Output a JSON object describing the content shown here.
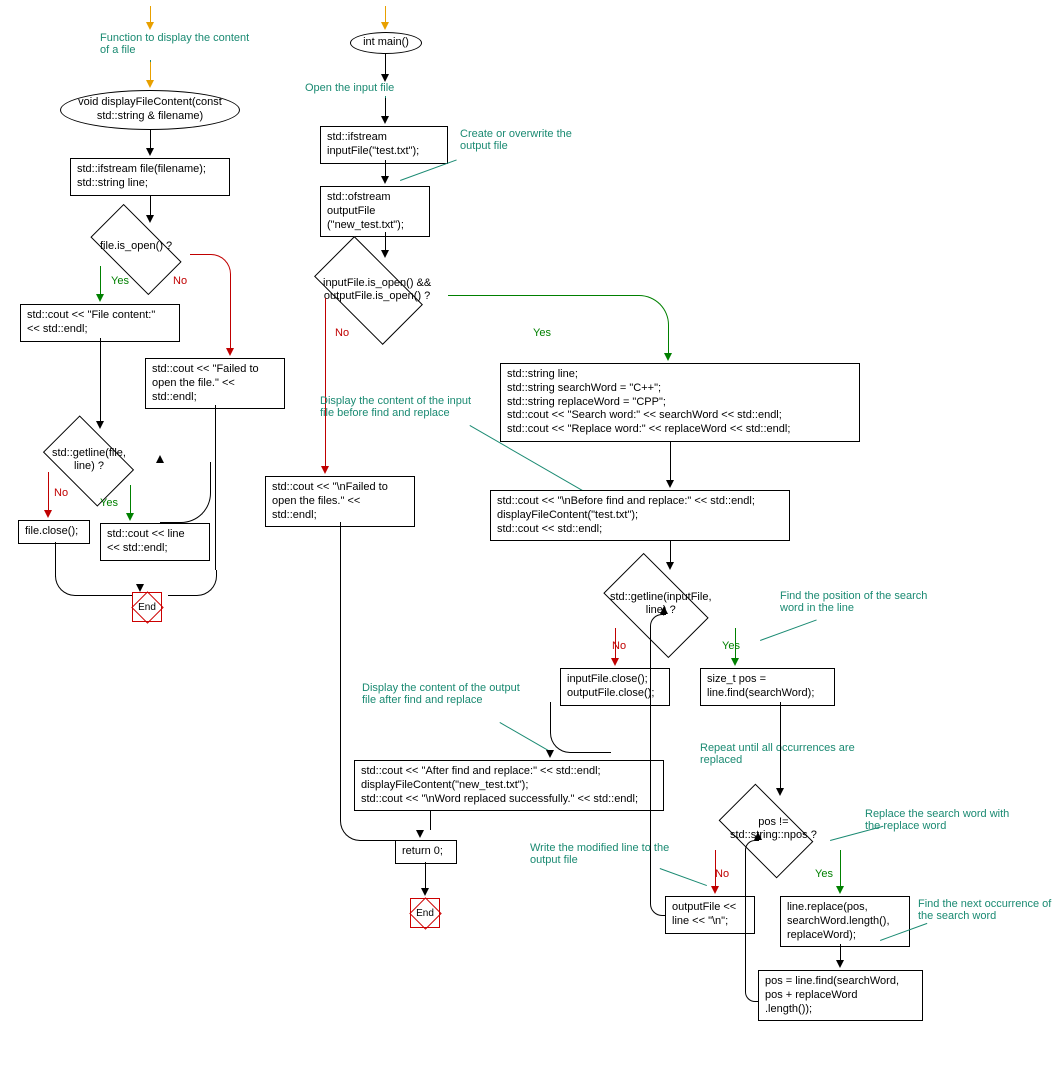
{
  "left": {
    "annot_func": "Function to display the\ncontent of a file",
    "func_decl": "void displayFileContent(const\nstd::string & filename)",
    "b1": "std::ifstream file(filename);\nstd::string line;",
    "d1": "file.is_open() ?",
    "yes1": "Yes",
    "no1": "No",
    "b2": "std::cout << \"File content:\"\n<< std::endl;",
    "b3": "std::cout << \"Failed to\nopen the file.\" <<\nstd::endl;",
    "d2": "std::getline(file,\nline) ?",
    "yes2": "Yes",
    "no2": "No",
    "b4": "file.close();",
    "b5": "std::cout << line\n<< std::endl;",
    "end": "End"
  },
  "right": {
    "main": "int main()",
    "annot_open": "Open the input file",
    "b1": "std::ifstream\ninputFile(\"test.txt\");",
    "annot_create": "Create or overwrite\nthe output file",
    "b2": "std::ofstream\noutputFile\n(\"new_test.txt\");",
    "d1": "inputFile.is_open() &&\noutputFile.is_open() ?",
    "yes1": "Yes",
    "no1": "No",
    "annot_before": "Display the content of the\ninput file before find and\nreplace",
    "b3": "std::cout << \"\\nFailed to\nopen the files.\" <<\nstd::endl;",
    "b4": "std::string line;\nstd::string searchWord = \"C++\";\nstd::string replaceWord = \"CPP\";\nstd::cout << \"Search word:\" << searchWord << std::endl;\nstd::cout << \"Replace word:\" << replaceWord << std::endl;",
    "b5": "std::cout << \"\\nBefore find and replace:\" << std::endl;\ndisplayFileContent(\"test.txt\");\nstd::cout << std::endl;",
    "d2": "std::getline(inputFile,\nline) ?",
    "yes2": "Yes",
    "no2": "No",
    "annot_findpos": "Find the position of the\nsearch word in the line",
    "b6": "inputFile.close();\noutputFile.close();",
    "b7": "size_t pos =\nline.find(searchWord);",
    "annot_after": "Display the content of the\noutput file after find and\nreplace",
    "b8": "std::cout << \"After find and replace:\" << std::endl;\ndisplayFileContent(\"new_test.txt\");\nstd::cout << \"\\nWord replaced successfully.\" << std::endl;",
    "annot_repeat": "Repeat until all occurrences\nare replaced",
    "d3": "pos !=\nstd::string::npos ?",
    "yes3": "Yes",
    "no3": "No",
    "annot_replace": "Replace the search word\nwith the replace word",
    "annot_write": "Write the modified line\nto the output file",
    "b9": "outputFile <<\nline << \"\\n\";",
    "annot_findnext": "Find the next occurrence\nof the search word",
    "b10": "line.replace(pos,\nsearchWord.length(),\nreplaceWord);",
    "b11": "pos = line.find(searchWord,\npos + replaceWord\n.length());",
    "ret": "return 0;",
    "end": "End"
  }
}
